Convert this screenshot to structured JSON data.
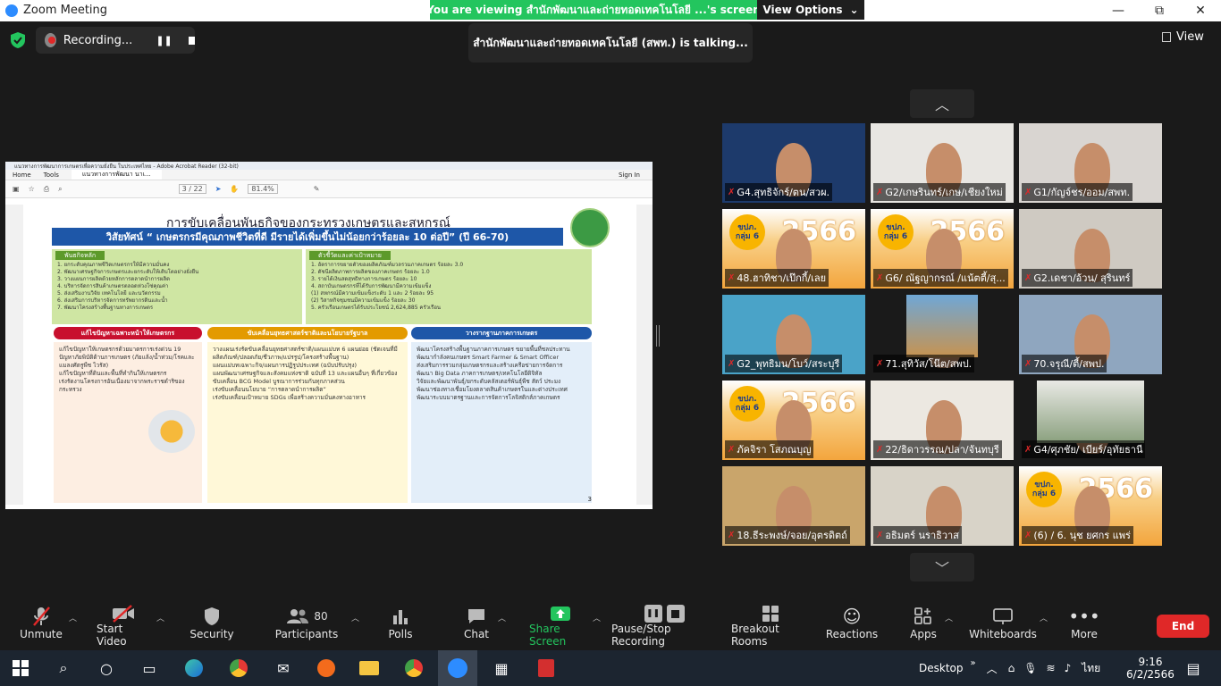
{
  "titlebar": {
    "app_title": "Zoom Meeting",
    "min": "—",
    "restore": "⧉",
    "close": "✕"
  },
  "banner": {
    "message": "You are viewing สำนักพัฒนาและถ่ายทอดเทคโนโลยี ...'s screen",
    "options_label": "View Options",
    "chevron": "⌄"
  },
  "top": {
    "recording_label": "Recording...",
    "talking": "สำนักพัฒนาและถ่ายทอดเทคโนโลยี (สพท.) is talking...",
    "view_label": "View"
  },
  "shared": {
    "window_title": "แนวทางการพัฒนาการเกษตรเพื่อความยั่งยืน ในประเทศไทย - Adobe Acrobat Reader (32-bit)",
    "menu": [
      "Home",
      "Tools",
      "แนวทางการพัฒนา นาเ..."
    ],
    "signin": "Sign In",
    "page_box": "3 / 22",
    "zoom_box": "81.4%",
    "slide": {
      "title": "การขับเคลื่อนพันธกิจของกระทรวงเกษตรและสหกรณ์",
      "vision": "วิสัยทัศน์ “ เกษตรกรมีคุณภาพชีวิตที่ดี มีรายได้เพิ่มขึ้นไม่น้อยกว่าร้อยละ 10 ต่อปี” (ปี 66-70)",
      "left_head": "พันธกิจหลัก",
      "left_items": [
        "1. ยกระดับคุณภาพชีวิตเกษตรกรให้มีความมั่นคง",
        "2. พัฒนาเศรษฐกิจการเกษตรและยกระดับให้เติบโตอย่างยั่งยืน",
        "3. วางแผนการผลิตด้วยหลักการตลาดนำการผลิต",
        "4. บริหารจัดการสินค้าเกษตรตลอดห่วงโซ่คุณค่า",
        "5. ส่งเสริมงานวิจัย เทคโนโลยี และนวัตกรรม",
        "6. ส่งเสริมการบริหารจัดการทรัพยากรดินและน้ำ",
        "7. พัฒนาโครงสร้างพื้นฐานทางการเกษตร"
      ],
      "right_head": "ตัวชี้วัดและค่าเป้าหมาย",
      "right_items": [
        "1. อัตราการขยายตัวของผลิตภัณฑ์มวลรวมภาคเกษตร ร้อยละ 3.0",
        "2. ดัชนีผลิตภาพการผลิตของภาคเกษตร ร้อยละ 1.0",
        "3. รายได้เงินสดสุทธิทางการเกษตร ร้อยละ 10",
        "4. สถาบันเกษตรกรที่ได้รับการพัฒนามีความเข้มแข็ง",
        "(1) สหกรณ์มีความเข้มแข็งระดับ 1 และ 2 ร้อยละ 95",
        "(2) วิสาหกิจชุมชนมีความเข้มแข็ง ร้อยละ 30",
        "5. ครัวเรือนเกษตรได้รับประโยชน์ 2,624,885 ครัวเรือน"
      ],
      "bars": [
        "แก้ไขปัญหาเฉพาะหน้าให้เกษตรกร",
        "ขับเคลื่อนยุทธศาสตร์ชาติและนโยบายรัฐบาล",
        "วางรากฐานภาคการเกษตร"
      ],
      "col1": [
        "แก้ไขปัญหาให้เกษตรกรด้วยมาตรการเร่งด่วน 19",
        "ปัญหาภัยพิบัติด้านการเกษตร (ภัยแล้ง/น้ำท่วม/โรคและแมลงศัตรูพืช ไวรัส)",
        "แก้ไขปัญหาที่ดินและพื้นที่ทำกินให้เกษตรกร",
        "เร่งรัดงานโครงการอันเนื่องมาจากพระราชดำริของกระทรวง"
      ],
      "col2": [
        "วางแผนเร่งรัดขับเคลื่อนยุทธศาสตร์ชาติ/แผนแม่บท 6 แผนย่อย (ชัดเจนที่มีผลิตภัณฑ์/ปลอดภัย/ชีวภาพ/แปรรูป/โครงสร้างพื้นฐาน)",
        "แผนแม่บทเฉพาะกิจ/แผนการปฏิรูปประเทศ (ฉบับปรับปรุง)",
        "แผนพัฒนาเศรษฐกิจและสังคมแห่งชาติ ฉบับที่ 13 และแผนอื่นๆ ที่เกี่ยวข้อง",
        "ขับเคลื่อน BCG Model บูรณาการร่วมกันทุกภาคส่วน",
        "เร่งขับเคลื่อนนโยบาย “การตลาดนำการผลิต”",
        "เร่งขับเคลื่อนเป้าหมาย SDGs เพื่อสร้างความมั่นคงทางอาหาร"
      ],
      "col3": [
        "พัฒนาโครงสร้างพื้นฐานภาคการเกษตร ขยายพื้นที่ชลประทาน",
        "พัฒนากำลังคนเกษตร Smart Farmer & Smart Officer",
        "ส่งเสริมการรวมกลุ่มเกษตรกรและสร้างเครือข่ายการจัดการ",
        "พัฒนา Big Data ภาคการเกษตร/เทคโนโลยีดิจิทัล",
        "วิจัยและพัฒนาพันธุ์/ยกระดับคลัสเตอร์พันธุ์พืช สัตว์ ประมง",
        "พัฒนาช่องทางเชื่อมโยงตลาดสินค้าเกษตรในและต่างประเทศ",
        "พัฒนาระบบมาตรฐานและการจัดการโลจิสติกส์ภาคเกษตร"
      ],
      "page_num": "3"
    }
  },
  "gallery": {
    "participants": [
      {
        "name": "G4.สุทธิจักร์/ตน/สวผ.",
        "bg": "#1d3a6b"
      },
      {
        "name": "G2/เกษรินทร์/เกษ/เชียงใหม่",
        "bg": "#e8e6e2"
      },
      {
        "name": "G1/กัญจ์ชร/ออม/สพท.",
        "bg": "#d9d5d1"
      },
      {
        "name": "48.ฮาทิชา/เป๊กกี้/เลย",
        "bg": "#f3a53d"
      },
      {
        "name": "G6/ ณัฐญากรณ์ /แน้ตตี้/สุ...",
        "bg": "#f3a53d"
      },
      {
        "name": "G2.เดชา/อ้วน/ สุรินทร์",
        "bg": "#cfcac2"
      },
      {
        "name": "G2_พุทธิมน/โบว์/สระบุรี",
        "bg": "#4aa3c8"
      },
      {
        "name": "71.สุทิวัส/โน๊ต/สพป.",
        "bg": "#1a1a1a"
      },
      {
        "name": "70.จรุณี/ตี้/สพป.",
        "bg": "#8fa6bf"
      },
      {
        "name": "ภัคจิรา โสภณบุญ",
        "bg": "#f3a53d"
      },
      {
        "name": "22/ธิดาวรรณ/ปลา/จันทบุรี",
        "bg": "#ece8e1"
      },
      {
        "name": "G4/ศุภชัย/ เบียร์/อุทัยธานี",
        "bg": "#1a1a1a"
      },
      {
        "name": "18.ธีระพงษ์/จอย/อุตรดิตถ์",
        "bg": "#c9a56b"
      },
      {
        "name": "อธิมตร์ นราธิวาส",
        "bg": "#d8d3c8"
      },
      {
        "name": "(6) / 6. นุช ยศกร แพร่",
        "bg": "#f3a53d"
      }
    ],
    "badge_text": "ขปภ. กลุ่ม 6",
    "year_text": "2566"
  },
  "toolbar": {
    "items": [
      "Unmute",
      "Start Video",
      "Security",
      "Participants",
      "Polls",
      "Chat",
      "Share Screen",
      "Pause/Stop Recording",
      "Breakout Rooms",
      "Reactions",
      "Apps",
      "Whiteboards",
      "More"
    ],
    "participant_count": "80",
    "end_label": "End"
  },
  "taskbar": {
    "desktop_label": "Desktop",
    "lang": "ไทย",
    "time": "9:16",
    "date": "6/2/2566"
  },
  "colors": {
    "accent_green": "#23c55e",
    "end_red": "#e02828",
    "zoom_blue": "#2d8cff"
  }
}
